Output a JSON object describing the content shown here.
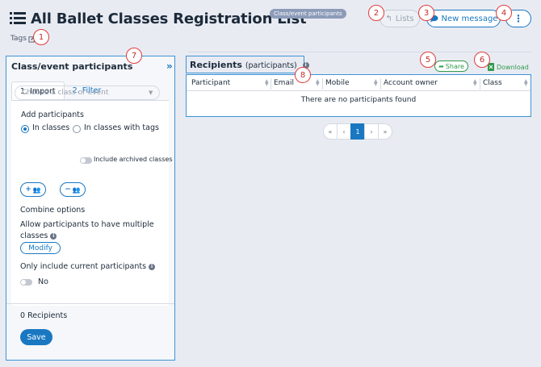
{
  "header": {
    "title": "All Ballet Classes Registration List",
    "type_badge": "Class/event participants",
    "tags_label": "Tags",
    "lists_label": "Lists",
    "new_message_label": "New message",
    "more_label": "⋮"
  },
  "callouts": [
    "1",
    "2",
    "3",
    "4",
    "5",
    "6",
    "7",
    "8"
  ],
  "left_panel": {
    "title": "Class/event participants",
    "collapse_icon": "»",
    "tabs": [
      "1. Import",
      "2. Filter"
    ],
    "add_participants_label": "Add participants",
    "radio_in_classes": "In classes",
    "radio_in_classes_tags": "In classes with tags",
    "select_placeholder": "Choose a class or event",
    "include_archived": "Include archived classes",
    "add_group_label": "+",
    "remove_group_label": "−",
    "combine_options": "Combine options",
    "allow_multiple_line1": "Allow participants to have multiple",
    "allow_multiple_line2": "classes",
    "modify_label": "Modify",
    "only_current": "Only include current participants",
    "only_current_value": "No",
    "recipients_count": "0 Recipients",
    "save_label": "Save"
  },
  "recipients": {
    "title": "Recipients",
    "subtitle": "(participants)",
    "share_label": "Share",
    "download_label": "Download",
    "columns": [
      "Participant",
      "Email",
      "Mobile",
      "Account owner",
      "Class"
    ],
    "empty_message": "There are no participants found"
  },
  "pager": {
    "first": "«",
    "prev": "‹",
    "current": "1",
    "next": "›",
    "last": "»"
  },
  "colors": {
    "accent": "#1a78c2",
    "panel_border": "#3c94d6",
    "callout": "#e03b3b",
    "share": "#2e9a4a",
    "background": "#e9ebf3"
  }
}
